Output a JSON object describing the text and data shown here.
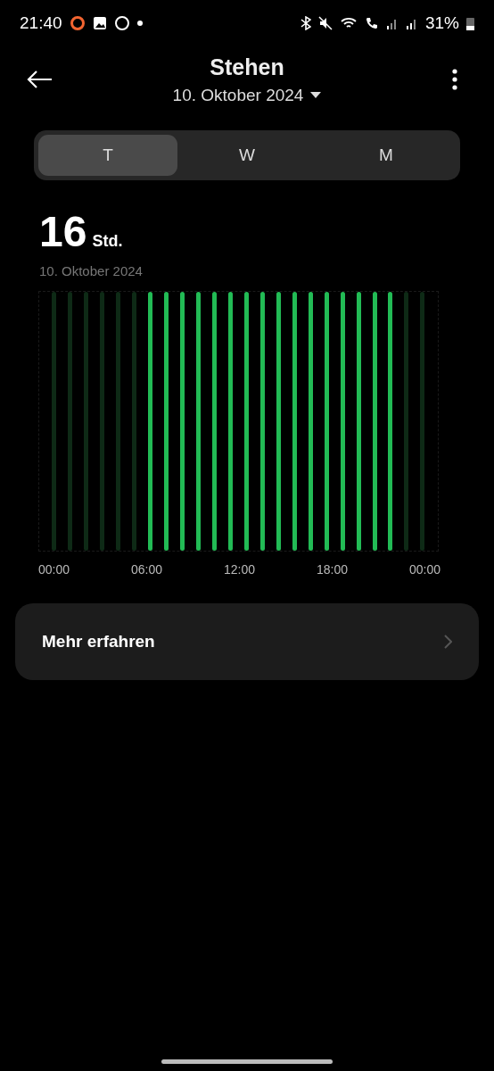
{
  "status_bar": {
    "time": "21:40",
    "battery": "31%"
  },
  "header": {
    "title": "Stehen",
    "date": "10. Oktober 2024"
  },
  "tabs": [
    {
      "label": "T",
      "selected": true
    },
    {
      "label": "W",
      "selected": false
    },
    {
      "label": "M",
      "selected": false
    }
  ],
  "summary": {
    "value": "16",
    "unit": "Std.",
    "date": "10. Oktober 2024"
  },
  "chart": {
    "hours": [
      {
        "active": false
      },
      {
        "active": false
      },
      {
        "active": false
      },
      {
        "active": false
      },
      {
        "active": false
      },
      {
        "active": false
      },
      {
        "active": true
      },
      {
        "active": true
      },
      {
        "active": true
      },
      {
        "active": true
      },
      {
        "active": true
      },
      {
        "active": true
      },
      {
        "active": true
      },
      {
        "active": true
      },
      {
        "active": true
      },
      {
        "active": true
      },
      {
        "active": true
      },
      {
        "active": true
      },
      {
        "active": true
      },
      {
        "active": true
      },
      {
        "active": true
      },
      {
        "active": true
      },
      {
        "active": false
      },
      {
        "active": false
      }
    ],
    "x_labels": [
      "00:00",
      "06:00",
      "12:00",
      "18:00",
      "00:00"
    ]
  },
  "card": {
    "label": "Mehr erfahren"
  }
}
